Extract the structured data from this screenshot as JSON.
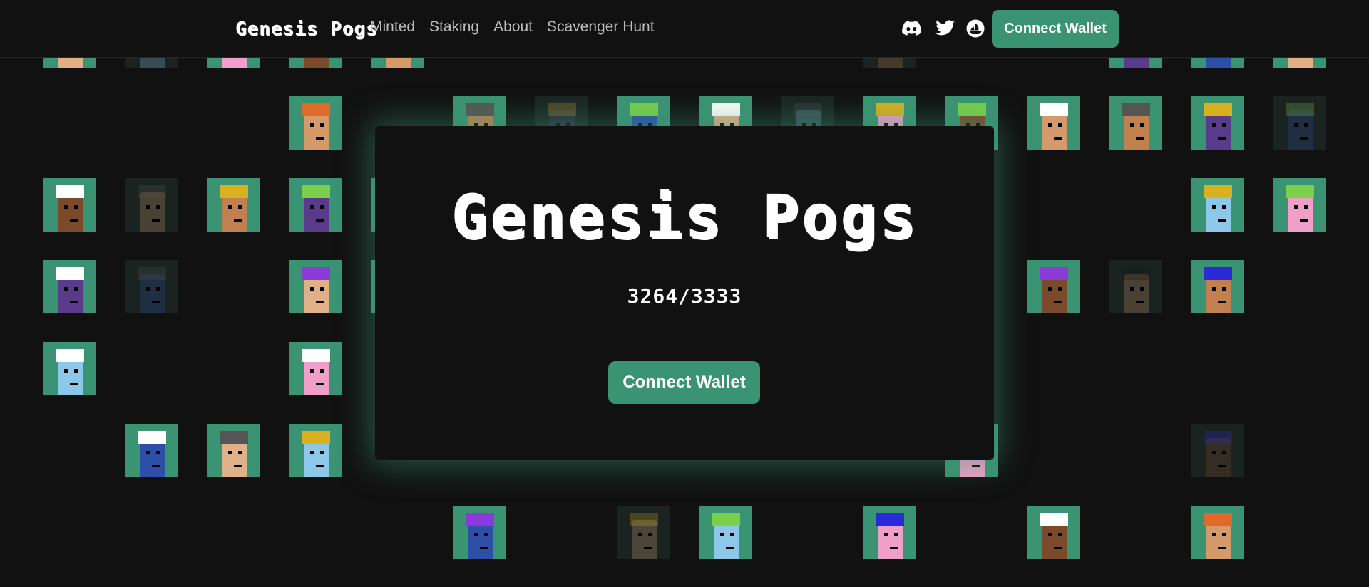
{
  "nav": {
    "logo": "Genesis Pogs",
    "links": [
      "Minted",
      "Staking",
      "About",
      "Scavenger Hunt"
    ],
    "social_icons": [
      "discord-icon",
      "twitter-icon",
      "opensea-icon"
    ],
    "connect_label": "Connect Wallet"
  },
  "modal": {
    "title": "Genesis Pogs",
    "minted_count": "3264/3333",
    "connect_label": "Connect Wallet"
  },
  "colors": {
    "background": "#111111",
    "accent": "#3a9373",
    "text": "#ffffff",
    "nav_link": "#bdbdbd"
  }
}
